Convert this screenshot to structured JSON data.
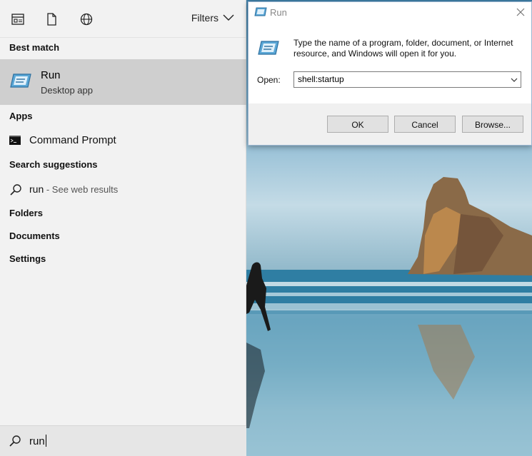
{
  "search_panel": {
    "filters_label": "Filters",
    "best_match_heading": "Best match",
    "best_match": {
      "title": "Run",
      "subtitle": "Desktop app"
    },
    "apps_heading": "Apps",
    "apps": [
      {
        "label": "Command Prompt",
        "icon": "command-prompt-icon"
      }
    ],
    "search_suggestions_heading": "Search suggestions",
    "suggestion": {
      "query": "run",
      "hint": " - See web results"
    },
    "folders_heading": "Folders",
    "documents_heading": "Documents",
    "settings_heading": "Settings",
    "search_query": "run"
  },
  "run_dialog": {
    "title": "Run",
    "description": "Type the name of a program, folder, document, or Internet resource, and Windows will open it for you.",
    "open_label": "Open:",
    "open_value": "shell:startup",
    "buttons": {
      "ok": "OK",
      "cancel": "Cancel",
      "browse": "Browse..."
    }
  },
  "colors": {
    "selected_bg": "#cfcfcf",
    "panel_bg": "#f2f2f2",
    "button_bg": "#e1e1e1"
  }
}
